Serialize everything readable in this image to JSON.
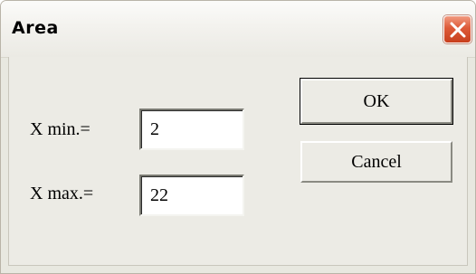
{
  "window": {
    "title": "Area"
  },
  "icons": {
    "close": "close-icon"
  },
  "form": {
    "xmin_label": "X min.=",
    "xmin_value": "2",
    "xmax_label": "X max.=",
    "xmax_value": "22"
  },
  "buttons": {
    "ok_label": "OK",
    "cancel_label": "Cancel"
  },
  "colors": {
    "close_button": "#dd5a38"
  }
}
